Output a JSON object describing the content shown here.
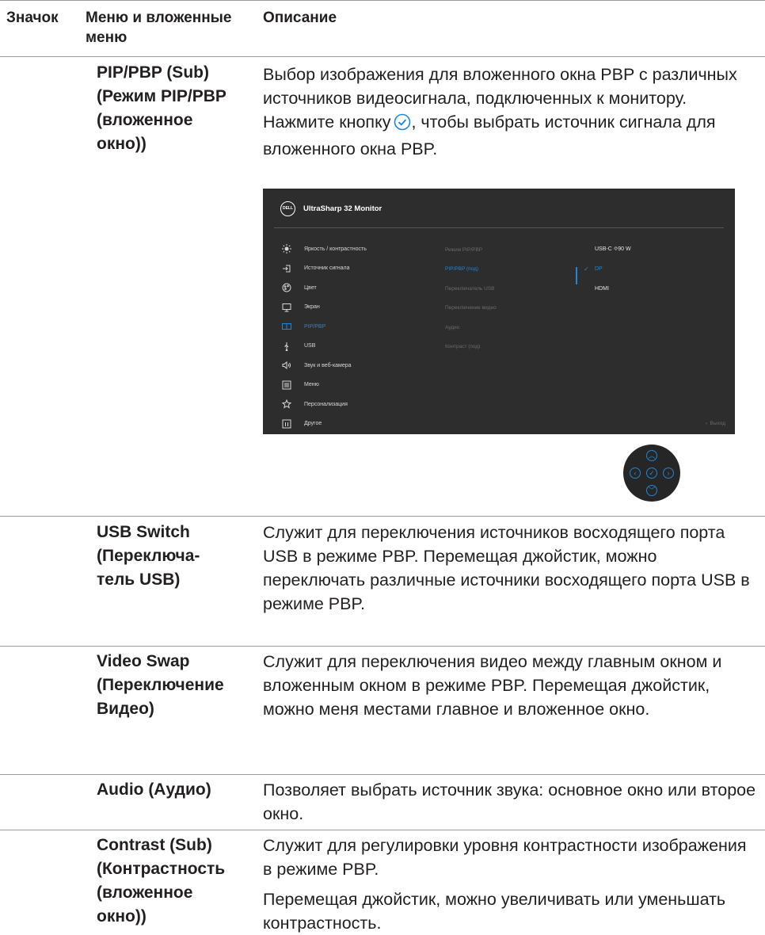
{
  "header": {
    "col_icon": "Значок",
    "col_menu": "Меню и вложенные меню",
    "col_desc": "Описание"
  },
  "rows": [
    {
      "menu": "PIP/PBP (Sub) (Режим PIP/PBP (вложенное окно))",
      "desc_before_icon": "Выбор изображения для вложенного окна PBP с различных источников видеосигнала, подключенных к монитору. Нажмите кнопку",
      "desc_after_icon": ", чтобы выбрать источник сигнала для вложенного окна PBP."
    },
    {
      "menu": "USB Switch (Переключа-тель USB)",
      "desc": "Служит для переключения источников восходящего порта USB в режиме PBP. Перемещая джойстик, можно переключать различные источники восходящего порта USB в режиме PBP."
    },
    {
      "menu": "Video Swap (Переключение Видео)",
      "desc": "Служит для переключения видео между главным окном и вложенным окном в режиме PBP. Перемещая джойстик, можно меня местами главное и вложенное окно."
    },
    {
      "menu": "Audio (Аудио)",
      "desc": "Позволяет выбрать источник звука: основное окно или второе окно."
    },
    {
      "menu": "Contrast (Sub) (Контрастность (вложенное окно))",
      "desc_p1": "Служит для регулировки уровня контрастности изображения в режиме PBP.",
      "desc_p2": "Перемещая джойстик, можно увеличивать или уменьшать контрастность."
    }
  ],
  "osd": {
    "logo": "DELL",
    "title": "UltraSharp 32 Monitor",
    "menu": [
      {
        "label": "Яркость / контрастность",
        "icon": "sun-icon"
      },
      {
        "label": "Источник сигнала",
        "icon": "input-source-icon"
      },
      {
        "label": "Цвет",
        "icon": "palette-icon"
      },
      {
        "label": "Экран",
        "icon": "display-icon"
      },
      {
        "label": "PIP/PBP",
        "icon": "pip-icon",
        "active": true
      },
      {
        "label": "USB",
        "icon": "usb-icon"
      },
      {
        "label": "Звук и веб-камера",
        "icon": "speaker-icon"
      },
      {
        "label": "Меню",
        "icon": "menu-icon"
      },
      {
        "label": "Персонализация",
        "icon": "star-icon"
      },
      {
        "label": "Другое",
        "icon": "info-icon"
      }
    ],
    "submenu": [
      "Режим PIP/PBP",
      "PIP/PBP (под)",
      "Переключатель USB",
      "Переключение видео",
      "Аудио",
      "Контраст (под)"
    ],
    "options": [
      "USB-C ⯑90 W",
      "DP",
      "HDMI"
    ],
    "exit": "Выход",
    "accent": "#1e86d6"
  }
}
